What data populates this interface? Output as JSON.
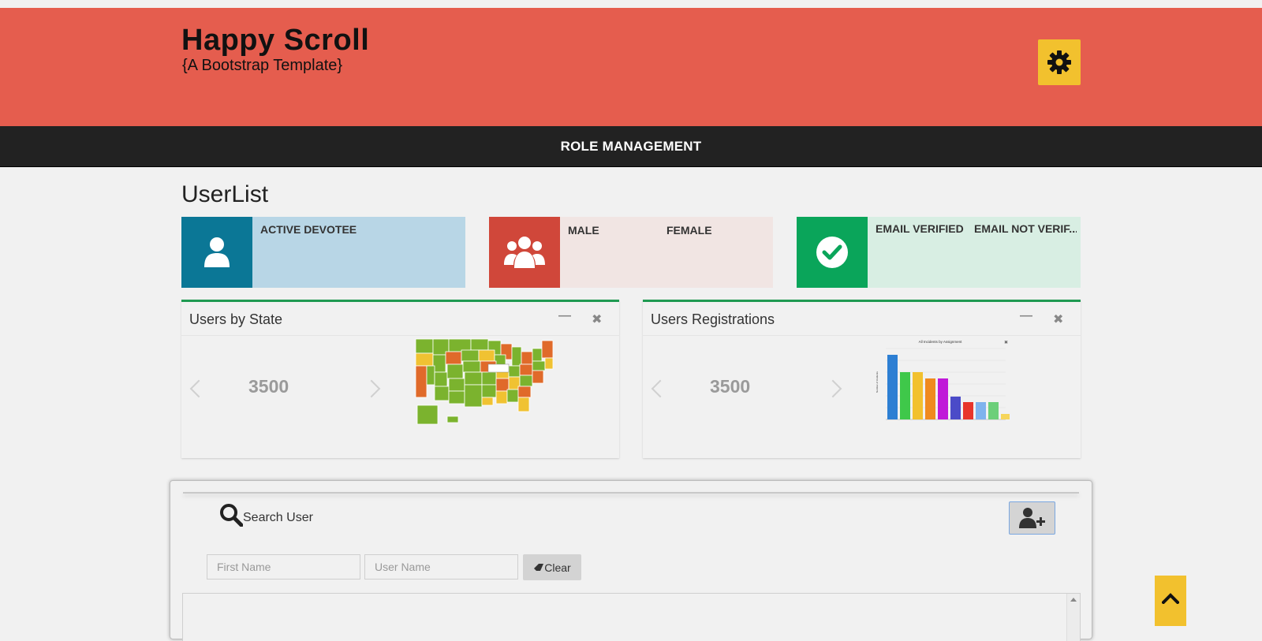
{
  "header": {
    "title": "Happy Scroll",
    "subtitle": "{A Bootstrap Template}",
    "background": "#e55d4e",
    "settings_icon": "gear-icon"
  },
  "navbar": {
    "items": [
      {
        "label": "ROLE MANAGEMENT"
      }
    ]
  },
  "page": {
    "title": "UserList"
  },
  "stats": [
    {
      "icon": "user-icon",
      "icon_bg": "#0b7796",
      "body_bg": "#b8d6e6",
      "labels": [
        "ACTIVE DEVOTEE"
      ]
    },
    {
      "icon": "users-group-icon",
      "icon_bg": "#d0473a",
      "body_bg": "#f1e5e3",
      "labels": [
        "MALE",
        "FEMALE"
      ]
    },
    {
      "icon": "check-circle-icon",
      "icon_bg": "#0aa55a",
      "body_bg": "#d8eee3",
      "labels": [
        "EMAIL VERIFIED",
        "EMAIL NOT VERIF..."
      ]
    }
  ],
  "panels": [
    {
      "title": "Users by State",
      "value": "3500",
      "image": "us-choropleth-map",
      "accent": "#1f9a52"
    },
    {
      "title": "Users Registrations",
      "value": "3500",
      "image": "bar-chart-thumbnail",
      "chart_title": "All Incidents by Assignment",
      "accent": "#1f9a52"
    }
  ],
  "search": {
    "title": "Search User",
    "first_name_placeholder": "First Name",
    "user_name_placeholder": "User Name",
    "clear_label": "Clear",
    "add_user_icon": "add-user-icon"
  },
  "colors": {
    "accent_yellow": "#f2c12e",
    "navbar": "#222222"
  }
}
